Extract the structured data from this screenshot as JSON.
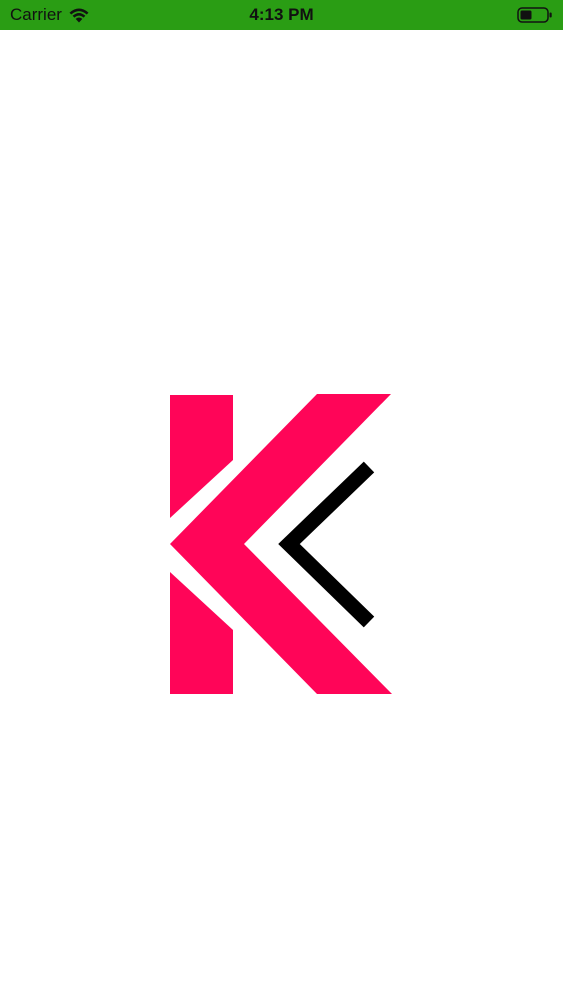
{
  "status_bar": {
    "carrier": "Carrier",
    "time": "4:13 PM",
    "background_color": "#2a9d14",
    "icons": [
      "wifi-icon",
      "battery-icon"
    ]
  },
  "splash": {
    "logo": "k-logo",
    "colors": {
      "primary": "#ff0558",
      "accent": "#000000",
      "background": "#ffffff"
    }
  }
}
